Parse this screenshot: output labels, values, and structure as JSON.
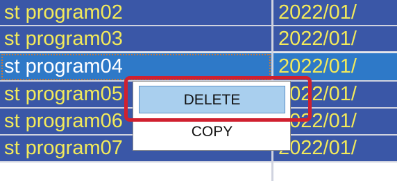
{
  "list": {
    "rows": [
      {
        "name": "st program02",
        "date": "2022/01/"
      },
      {
        "name": "st program03",
        "date": "2022/01/"
      },
      {
        "name": "st program04",
        "date": "2022/01/"
      },
      {
        "name": "st program05",
        "date": "2022/01/"
      },
      {
        "name": "st program06",
        "date": "2022/01/"
      },
      {
        "name": "st program07",
        "date": "2022/01/"
      }
    ]
  },
  "context_menu": {
    "delete_label": "DELETE",
    "copy_label": "COPY"
  },
  "colors": {
    "row_bg": "#3a57a7",
    "row_text": "#f3ea5a",
    "selected_bg": "#2e79c8",
    "highlight_border": "#d0202f"
  }
}
